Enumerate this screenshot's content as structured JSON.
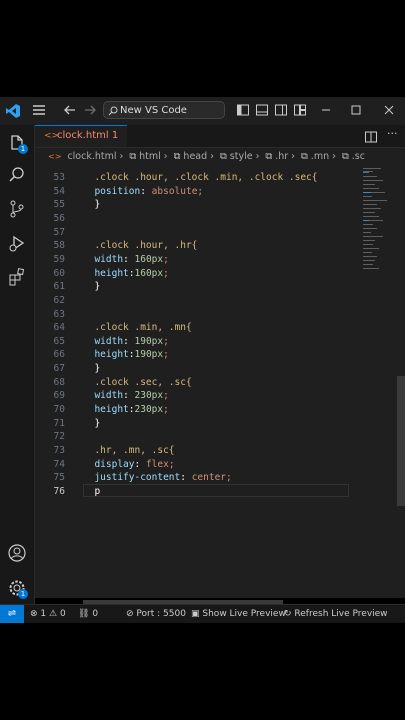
{
  "titlebar": {
    "search_label": "New VS Code"
  },
  "activity_bar": {
    "explorer_badge": "1",
    "accounts_badge": "",
    "settings_badge": "1"
  },
  "tab": {
    "filename": "clock.html",
    "problems": "1"
  },
  "breadcrumb": [
    "clock.html",
    "html",
    "head",
    "style",
    ".hr",
    ".mn",
    ".sc"
  ],
  "editor": {
    "lines": [
      {
        "n": "53",
        "text": "  .clock .hour, .clock .min, .clock .sec{"
      },
      {
        "n": "54",
        "text": "  position: absolute;"
      },
      {
        "n": "55",
        "text": "  }"
      },
      {
        "n": "56",
        "text": ""
      },
      {
        "n": "57",
        "text": ""
      },
      {
        "n": "58",
        "text": "  .clock .hour, .hr{"
      },
      {
        "n": "59",
        "text": "  width: 160px;"
      },
      {
        "n": "60",
        "text": "  height:160px;"
      },
      {
        "n": "61",
        "text": "  }"
      },
      {
        "n": "62",
        "text": ""
      },
      {
        "n": "63",
        "text": ""
      },
      {
        "n": "64",
        "text": "  .clock .min, .mn{"
      },
      {
        "n": "65",
        "text": "  width: 190px;"
      },
      {
        "n": "66",
        "text": "  height:190px;"
      },
      {
        "n": "67",
        "text": "  }"
      },
      {
        "n": "68",
        "text": "  .clock .sec, .sc{"
      },
      {
        "n": "69",
        "text": "  width: 230px;"
      },
      {
        "n": "70",
        "text": "  height:230px;"
      },
      {
        "n": "71",
        "text": "  }"
      },
      {
        "n": "72",
        "text": ""
      },
      {
        "n": "73",
        "text": "  .hr, .mn, .sc{"
      },
      {
        "n": "74",
        "text": "  display: flex;"
      },
      {
        "n": "75",
        "text": "  justify-content: center;"
      },
      {
        "n": "76",
        "text": "  p"
      }
    ]
  },
  "status": {
    "errors": "1",
    "warnings": "0",
    "ports": "0",
    "port_label": "Port : 5500",
    "live_preview": "Show Live Preview",
    "refresh_preview": "Refresh Live Preview"
  },
  "colors": {
    "accent": "#0078d4",
    "editor_bg": "#1f1f1f",
    "selector": "#d7ba7d",
    "property": "#9cdcfe",
    "value": "#ce9178",
    "number": "#b5cea8"
  }
}
